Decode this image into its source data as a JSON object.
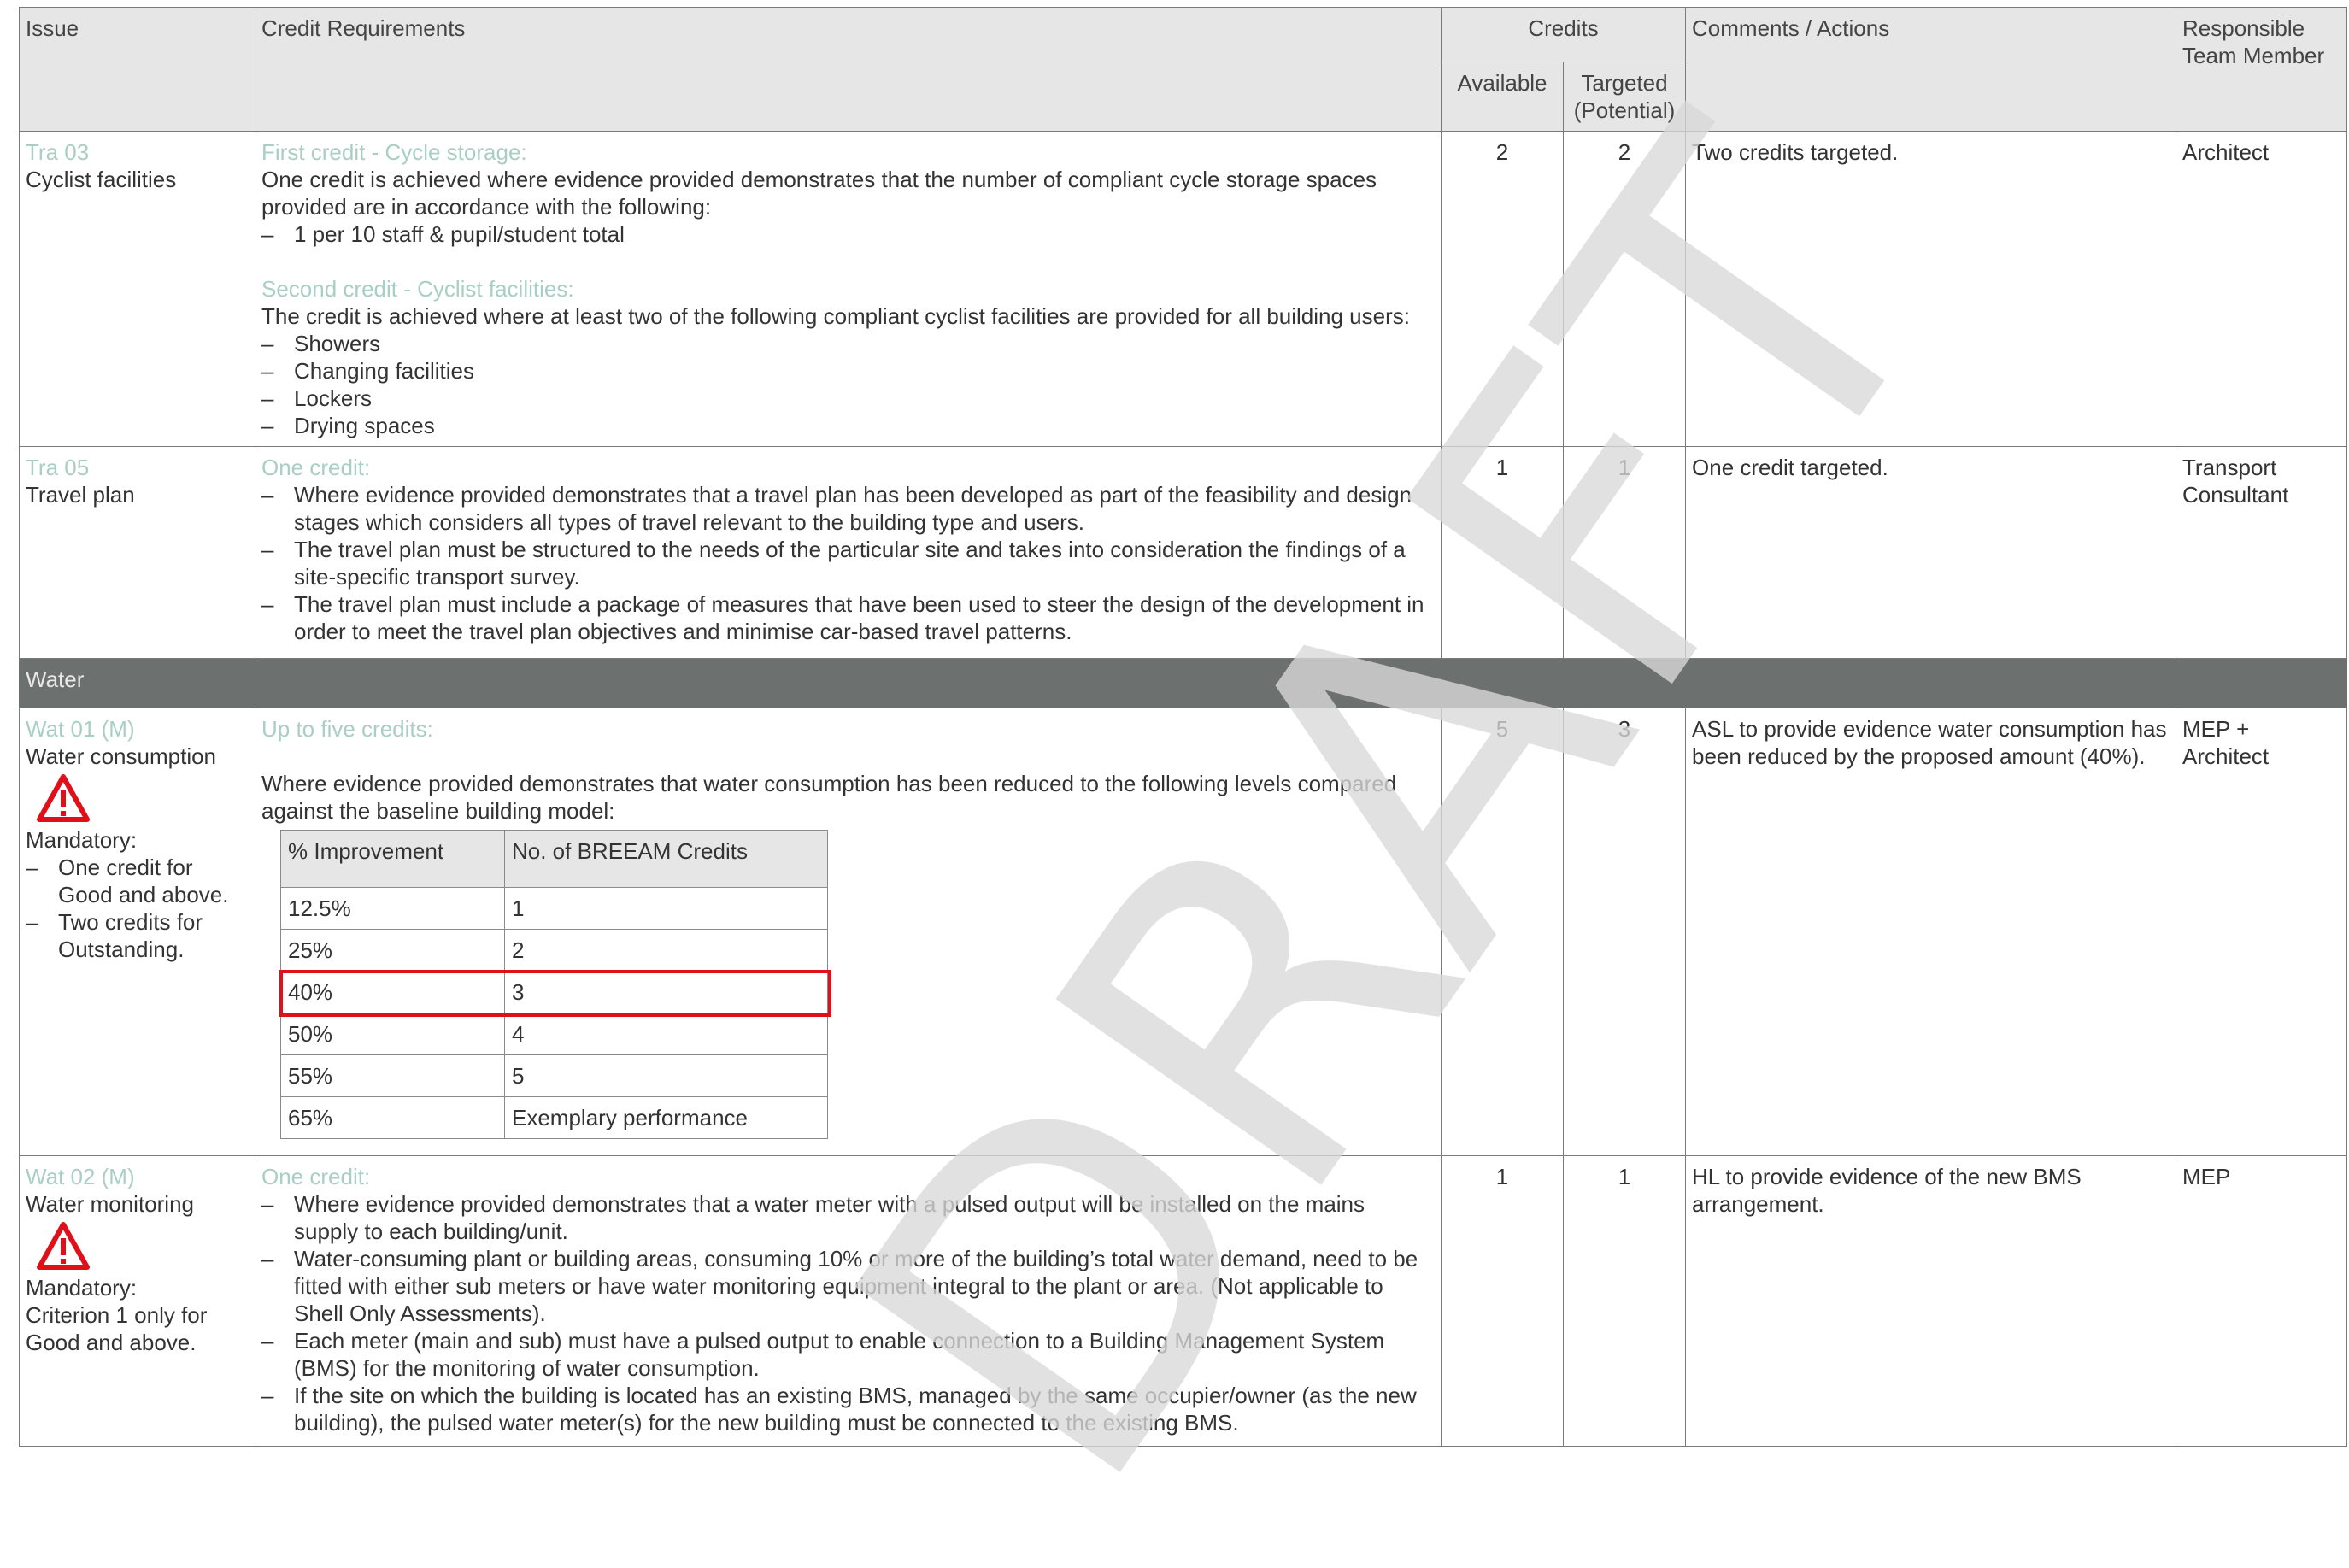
{
  "header": {
    "issue": "Issue",
    "credit_requirements": "Credit Requirements",
    "credits": "Credits",
    "available": "Available",
    "targeted": "Targeted (Potential)",
    "comments": "Comments / Actions",
    "responsible": "Responsible Team Member"
  },
  "rows": {
    "tra03": {
      "code": "Tra 03",
      "title": "Cyclist facilities",
      "first_heading": "First credit - Cycle storage:",
      "first_text": "One credit is achieved where evidence provided demonstrates that the number of compliant cycle storage spaces provided are in accordance with the following:",
      "first_bullets": [
        "1 per 10 staff & pupil/student total"
      ],
      "second_heading": "Second credit - Cyclist facilities:",
      "second_text": "The credit is achieved where at least two of the following compliant cyclist facilities are provided for all building users:",
      "second_bullets": [
        "Showers",
        "Changing facilities",
        "Lockers",
        "Drying spaces"
      ],
      "available": "2",
      "targeted": "2",
      "comment": "Two credits targeted.",
      "responsible": "Architect"
    },
    "tra05": {
      "code": "Tra 05",
      "title": "Travel plan",
      "heading": "One credit:",
      "bullets": [
        "Where evidence provided demonstrates that a travel plan has been developed as part of the feasibility and design stages which considers all types of travel relevant to the building type and users.",
        "The travel plan must be structured to the needs of the particular site and takes into consideration the findings of a site-specific transport survey.",
        "The travel plan must include a package of measures that have been used to steer the design of the development in order to meet the travel plan objectives and minimise car-based travel patterns."
      ],
      "available": "1",
      "targeted": "1",
      "comment": "One credit targeted.",
      "responsible": "Transport Consultant"
    },
    "section_water": "Water",
    "wat01": {
      "code": "Wat 01 (M)",
      "title": "Water consumption",
      "mandatory_label": "Mandatory:",
      "mandatory_bullets": [
        "One credit for Good and above.",
        "Two credits for Outstanding."
      ],
      "heading": "Up to five credits:",
      "text": "Where evidence provided demonstrates that water consumption has been reduced to the following levels compared against the baseline building model:",
      "table_headers": [
        "% Improvement",
        "No. of BREEAM Credits"
      ],
      "table_rows": [
        [
          "12.5%",
          "1"
        ],
        [
          "25%",
          "2"
        ],
        [
          "40%",
          "3"
        ],
        [
          "50%",
          "4"
        ],
        [
          "55%",
          "5"
        ],
        [
          "65%",
          "Exemplary performance"
        ]
      ],
      "highlighted_row": 2,
      "available": "5",
      "targeted": "3",
      "comment": "ASL to provide evidence water consumption has been reduced by the proposed amount (40%).",
      "responsible": "MEP + Architect"
    },
    "wat02": {
      "code": "Wat 02 (M)",
      "title": "Water monitoring",
      "mandatory_label": "Mandatory:",
      "mandatory_text": "Criterion 1 only for Good and above.",
      "heading": "One credit:",
      "bullets": [
        "Where evidence provided demonstrates that a water meter with a pulsed output will be installed on the mains supply to each building/unit.",
        "Water-consuming plant or building areas, consuming 10% or more of the building’s total water demand, need to be fitted with either sub meters or have water monitoring equipment integral to the plant or area. (Not applicable to Shell Only Assessments).",
        "Each meter (main and sub) must have a pulsed output to enable connection to a Building Management System (BMS) for the monitoring of water consumption.",
        "If the site on which the building is located has an existing BMS, managed by the same occupier/owner (as the new building), the pulsed water meter(s) for the new building must be connected to the existing BMS."
      ],
      "available": "1",
      "targeted": "1",
      "comment": "HL to provide evidence of the new BMS arrangement.",
      "responsible": "MEP"
    }
  },
  "watermark": "DRAFT",
  "colors": {
    "accent_teal": "#a9cfc4",
    "section_bg": "#6c706e",
    "header_bg": "#e6e6e6",
    "highlight_red": "#e0101a",
    "warning_red": "#e0101a"
  },
  "icons": {
    "warning": "warning-triangle-icon"
  }
}
